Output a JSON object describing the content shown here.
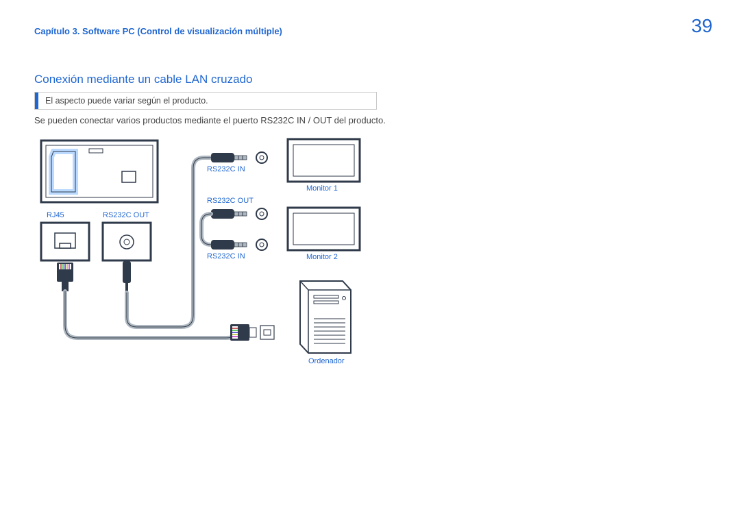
{
  "header": {
    "breadcrumb": "Capítulo 3. Software PC (Control de visualización múltiple)",
    "page_number": "39"
  },
  "section": {
    "title": "Conexión mediante un cable LAN cruzado",
    "note": "El aspecto puede variar según el producto.",
    "body": "Se pueden conectar varios productos mediante el puerto RS232C IN / OUT del producto."
  },
  "diagram": {
    "labels": {
      "rj45": "RJ45",
      "rs232c_out_left": "RS232C OUT",
      "rs232c_in_top": "RS232C IN",
      "rs232c_out_mid": "RS232C OUT",
      "rs232c_in_bottom": "RS232C IN",
      "monitor1": "Monitor 1",
      "monitor2": "Monitor 2",
      "computer": "Ordenador"
    }
  }
}
